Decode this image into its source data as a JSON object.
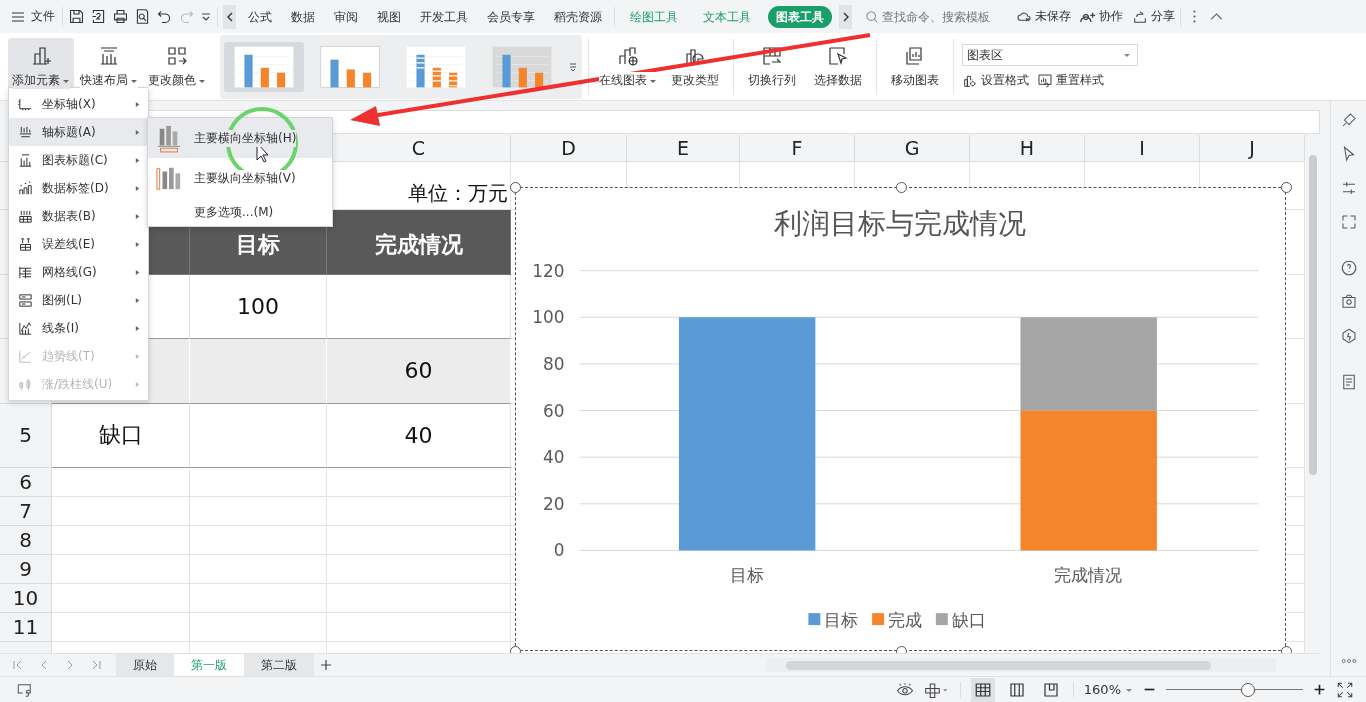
{
  "menu_bar": {
    "file": "文件",
    "tabs": [
      {
        "label": "公式",
        "selected": false
      },
      {
        "label": "数据",
        "selected": false
      },
      {
        "label": "审阅",
        "selected": false
      },
      {
        "label": "视图",
        "selected": false
      },
      {
        "label": "开发工具",
        "selected": false
      },
      {
        "label": "会员专享",
        "selected": false
      },
      {
        "label": "稻壳资源",
        "selected": false
      }
    ],
    "context_tabs": [
      {
        "label": "绘图工具",
        "selected": false
      },
      {
        "label": "文本工具",
        "selected": false
      },
      {
        "label": "图表工具",
        "selected": true
      }
    ],
    "search": {
      "placeholder": "查找命令、搜索模板"
    },
    "actions": [
      {
        "label": "未保存",
        "kind": "cloud"
      },
      {
        "label": "协作",
        "kind": "people"
      },
      {
        "label": "分享",
        "kind": "share"
      }
    ]
  },
  "ribbon": {
    "left_buttons": [
      {
        "label": "添加元素",
        "kind": "add",
        "dropdown": true,
        "selected": true
      },
      {
        "label": "快速布局",
        "kind": "layout",
        "dropdown": true,
        "selected": false
      },
      {
        "label": "更改颜色",
        "kind": "color",
        "dropdown": true,
        "selected": false
      }
    ],
    "chart_styles": [
      {
        "kind": "plain",
        "selected": true
      },
      {
        "kind": "boxed",
        "selected": false
      },
      {
        "kind": "striped",
        "selected": false
      },
      {
        "kind": "shaded",
        "selected": false
      }
    ],
    "right_buttons": [
      {
        "label": "在线图表",
        "kind": "online",
        "dropdown": true
      },
      {
        "label": "更改类型",
        "kind": "type",
        "dropdown": false
      },
      {
        "label": "切换行列",
        "kind": "switch",
        "dropdown": false
      },
      {
        "label": "选择数据",
        "kind": "select",
        "dropdown": false
      },
      {
        "label": "移动图表",
        "kind": "move",
        "dropdown": false
      }
    ],
    "element_select": {
      "value": "图表区"
    },
    "format_buttons": [
      {
        "label": "设置格式",
        "kind": "format"
      },
      {
        "label": "重置样式",
        "kind": "reset"
      }
    ]
  },
  "add_element_menu": [
    {
      "label": "坐标轴(X)",
      "kind": "axis",
      "disabled": false,
      "selected": false
    },
    {
      "label": "轴标题(A)",
      "kind": "axis_title",
      "disabled": false,
      "selected": true
    },
    {
      "label": "图表标题(C)",
      "kind": "chart_title",
      "disabled": false,
      "selected": false
    },
    {
      "label": "数据标签(D)",
      "kind": "data_labels",
      "disabled": false,
      "selected": false
    },
    {
      "label": "数据表(B)",
      "kind": "data_table",
      "disabled": false,
      "selected": false
    },
    {
      "label": "误差线(E)",
      "kind": "error_bars",
      "disabled": false,
      "selected": false
    },
    {
      "label": "网格线(G)",
      "kind": "gridlines",
      "disabled": false,
      "selected": false
    },
    {
      "label": "图例(L)",
      "kind": "legend",
      "disabled": false,
      "selected": false
    },
    {
      "label": "线条(I)",
      "kind": "lines",
      "disabled": false,
      "selected": false
    },
    {
      "label": "趋势线(T)",
      "kind": "trendline",
      "disabled": true,
      "selected": false
    },
    {
      "label": "涨/跌柱线(U)",
      "kind": "updown",
      "disabled": true,
      "selected": false
    }
  ],
  "axis_title_submenu": [
    {
      "label": "主要横向坐标轴(H)",
      "kind": "horizontal",
      "selected": true
    },
    {
      "label": "主要纵向坐标轴(V)",
      "kind": "vertical",
      "selected": false
    },
    {
      "label": "更多选项...(M)",
      "kind": "more",
      "selected": false
    }
  ],
  "sheet": {
    "columns": [
      "C",
      "D",
      "E",
      "F",
      "G",
      "H",
      "I",
      "J"
    ],
    "rows": [
      {
        "kind": "unit",
        "c": "单位：万元"
      },
      {
        "kind": "header",
        "b": "目标",
        "c": "完成情况"
      },
      {
        "kind": "data",
        "shaded": false,
        "b": "100"
      },
      {
        "kind": "data",
        "shaded": true,
        "c": "60"
      },
      {
        "number": "5",
        "kind": "data",
        "shaded": false,
        "a": "缺口",
        "c": "40"
      },
      {
        "number": "6",
        "kind": "blank"
      },
      {
        "number": "7",
        "kind": "blank"
      },
      {
        "number": "8",
        "kind": "blank"
      },
      {
        "number": "9",
        "kind": "blank"
      },
      {
        "number": "10",
        "kind": "blank"
      },
      {
        "number": "11",
        "kind": "blank"
      },
      {
        "kind": "blank"
      }
    ]
  },
  "chart": {
    "chart_data": {
      "type": "bar",
      "title": "利润目标与完成情况",
      "categories": [
        "目标",
        "完成情况"
      ],
      "stacked": true,
      "grid": true,
      "legend": true,
      "ylim": [
        0,
        120
      ],
      "yticks": [
        0,
        20,
        40,
        60,
        80,
        100,
        120
      ],
      "series": [
        {
          "name": "目标",
          "color": "#5b9bd5",
          "values": [
            100,
            null
          ]
        },
        {
          "name": "完成",
          "color": "#f5852b",
          "values": [
            null,
            60
          ]
        },
        {
          "name": "缺口",
          "color": "#a5a5a5",
          "values": [
            null,
            40
          ]
        }
      ]
    }
  },
  "sheet_tabs": [
    {
      "label": "原始",
      "selected": false
    },
    {
      "label": "第一版",
      "selected": true
    },
    {
      "label": "第二版",
      "selected": false
    }
  ],
  "status_bar": {
    "views": [
      {
        "kind": "normal",
        "selected": true
      },
      {
        "kind": "page",
        "selected": false
      },
      {
        "kind": "break",
        "selected": false
      }
    ],
    "zoom": "160%",
    "zoom_slider": {
      "level": 0.6
    }
  }
}
